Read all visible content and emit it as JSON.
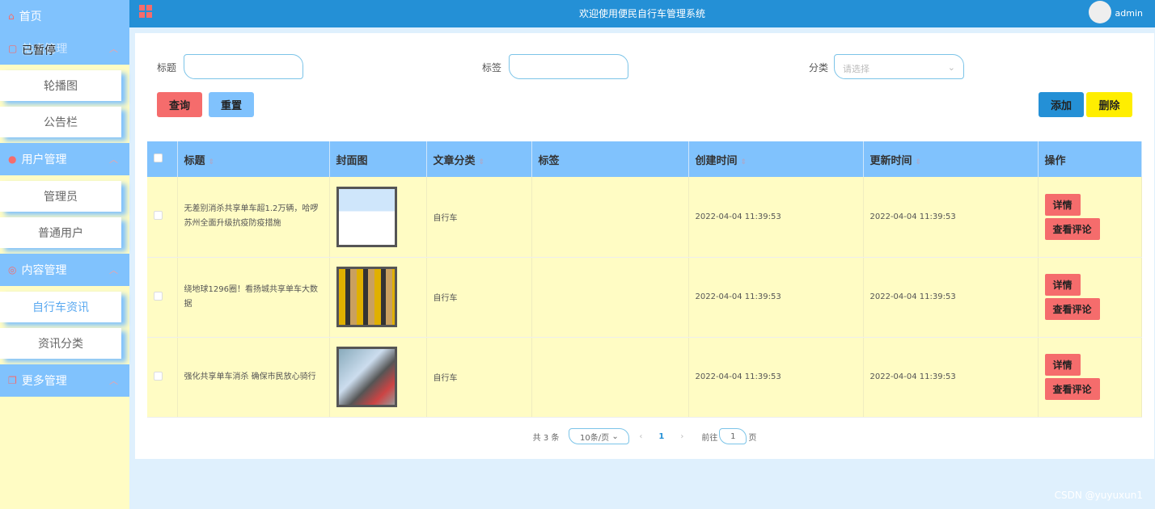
{
  "sidebar": {
    "home": "首页",
    "overlay": "已暂停",
    "groups": [
      {
        "label": "站点管理",
        "items": [
          "轮播图",
          "公告栏"
        ]
      },
      {
        "label": "用户管理",
        "items": [
          "管理员",
          "普通用户"
        ]
      },
      {
        "label": "内容管理",
        "items": [
          "自行车资讯",
          "资讯分类"
        ]
      },
      {
        "label": "更多管理",
        "items": []
      }
    ]
  },
  "header": {
    "title": "欢迎使用便民自行车管理系统",
    "user": "admin"
  },
  "search": {
    "title_label": "标题",
    "tag_label": "标签",
    "category_label": "分类",
    "category_placeholder": "请选择",
    "query": "查询",
    "reset": "重置",
    "add": "添加",
    "delete": "删除"
  },
  "table": {
    "columns": [
      "标题",
      "封面图",
      "文章分类",
      "标签",
      "创建时间",
      "更新时间",
      "操作"
    ],
    "rows": [
      {
        "title": "无差别消杀共享单车超1.2万辆，哈啰苏州全面升级抗疫防疫措施",
        "category": "自行车",
        "tag": "",
        "created": "2022-04-04 11:39:53",
        "updated": "2022-04-04 11:39:53"
      },
      {
        "title": "绕地球1296圈！看扬城共享单车大数据",
        "category": "自行车",
        "tag": "",
        "created": "2022-04-04 11:39:53",
        "updated": "2022-04-04 11:39:53"
      },
      {
        "title": "强化共享单车消杀 确保市民放心骑行",
        "category": "自行车",
        "tag": "",
        "created": "2022-04-04 11:39:53",
        "updated": "2022-04-04 11:39:53"
      }
    ],
    "detail": "详情",
    "comments": "查看评论"
  },
  "pager": {
    "total": "共 3 条",
    "size": "10条/页",
    "page": "1",
    "goto": "前往",
    "goto_value": "1",
    "page_suffix": "页"
  },
  "watermark": "CSDN @yuyuxun1"
}
